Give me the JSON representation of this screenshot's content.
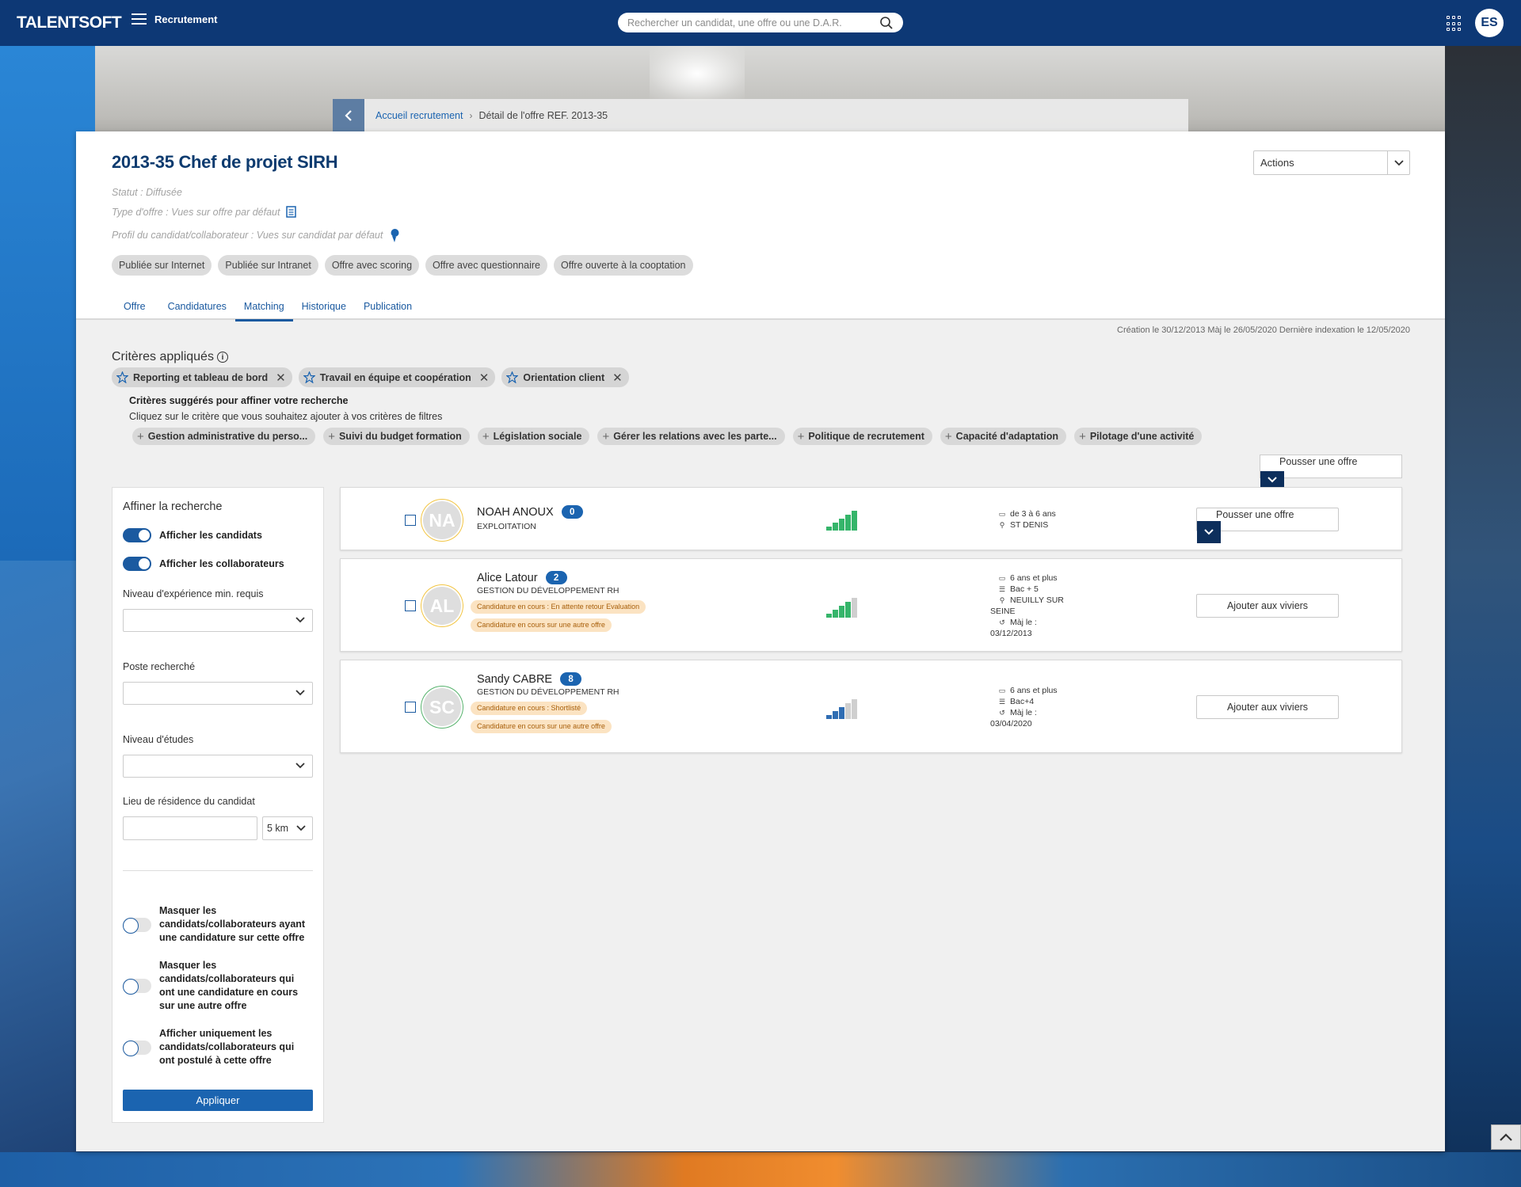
{
  "topbar": {
    "logo": "TALENTSOFT",
    "menu_label": "Recrutement",
    "search_placeholder": "Rechercher un candidat, une offre ou une D.A.R.",
    "user_initials": "ES"
  },
  "breadcrumb": {
    "home": "Accueil recrutement",
    "current": "Détail de l'offre REF. 2013-35"
  },
  "offer": {
    "title": "2013-35 Chef de projet SIRH",
    "actions_label": "Actions",
    "status": "Statut : Diffusée",
    "offer_type": "Type d'offre : Vues sur offre par défaut",
    "profile": "Profil du candidat/collaborateur : Vues sur candidat par défaut",
    "tags": [
      "Publiée sur Internet",
      "Publiée sur Intranet",
      "Offre avec scoring",
      "Offre avec questionnaire",
      "Offre ouverte à la cooptation"
    ],
    "tabs": [
      "Offre",
      "Candidatures",
      "Matching",
      "Historique",
      "Publication"
    ],
    "active_tab": "Matching",
    "dates": "Création le 30/12/2013 Màj le 26/05/2020 Dernière indexation le 12/05/2020"
  },
  "criteria": {
    "title": "Critères appliqués",
    "applied": [
      "Reporting et tableau de bord",
      "Travail en équipe et coopération",
      "Orientation client"
    ],
    "suggested_title": "Critères suggérés pour affiner votre recherche",
    "suggested_subtitle": "Cliquez sur le critère que vous souhaitez ajouter à vos critères de filtres",
    "suggested": [
      "Gestion administrative du perso...",
      "Suivi du budget formation",
      "Législation sociale",
      "Gérer les relations avec les parte...",
      "Politique de recrutement",
      "Capacité d'adaptation",
      "Pilotage d'une activité"
    ]
  },
  "push_offer_label": "Pousser une offre",
  "filters": {
    "title": "Affiner la recherche",
    "show_candidates": "Afficher les candidats",
    "show_collaborators": "Afficher les collaborateurs",
    "experience_label": "Niveau d'expérience min. requis",
    "position_label": "Poste recherché",
    "education_label": "Niveau d'études",
    "residence_label": "Lieu de résidence du candidat",
    "distance": "5 km",
    "hide_applied": "Masquer les candidats/collaborateurs ayant une candidature sur cette offre",
    "hide_other": "Masquer les candidats/collaborateurs qui ont une candidature en cours sur une autre offre",
    "only_applied": "Afficher uniquement les candidats/collaborateurs qui ont postulé à cette offre",
    "apply": "Appliquer"
  },
  "results": [
    {
      "initials": "NA",
      "name": "NOAH ANOUX",
      "count": "0",
      "department": "EXPLOITATION",
      "score_level": 5,
      "experience": "de 3 à 6 ans",
      "location": "ST DENIS",
      "action": "Pousser une offre"
    },
    {
      "initials": "AL",
      "name": "Alice Latour",
      "count": "2",
      "department": "GESTION DU DÉVELOPPEMENT RH",
      "status1": "Candidature en cours : En attente retour Evaluation",
      "status2": "Candidature en cours sur une autre offre",
      "score_level": 4,
      "experience": "6 ans et plus",
      "education": "Bac + 5",
      "location": "NEUILLY SUR",
      "location2": "SEINE",
      "updated_label": "Màj le :",
      "updated": "03/12/2013",
      "action": "Ajouter aux viviers"
    },
    {
      "initials": "SC",
      "name": "Sandy CABRE",
      "count": "8",
      "department": "GESTION DU DÉVELOPPEMENT RH",
      "status1": "Candidature en cours : Shortlisté",
      "status2": "Candidature en cours sur une autre offre",
      "score_level": 3,
      "experience": "6 ans et plus",
      "education": "Bac+4",
      "updated_label": "Màj le :",
      "updated": "03/04/2020",
      "action": "Ajouter aux viviers"
    }
  ],
  "colors": {
    "topbar": "#0d3875",
    "accent": "#1b5aa0",
    "score_green": "#35b56a",
    "score_blue": "#2f6db3",
    "score_gray": "#cfcfcf"
  }
}
